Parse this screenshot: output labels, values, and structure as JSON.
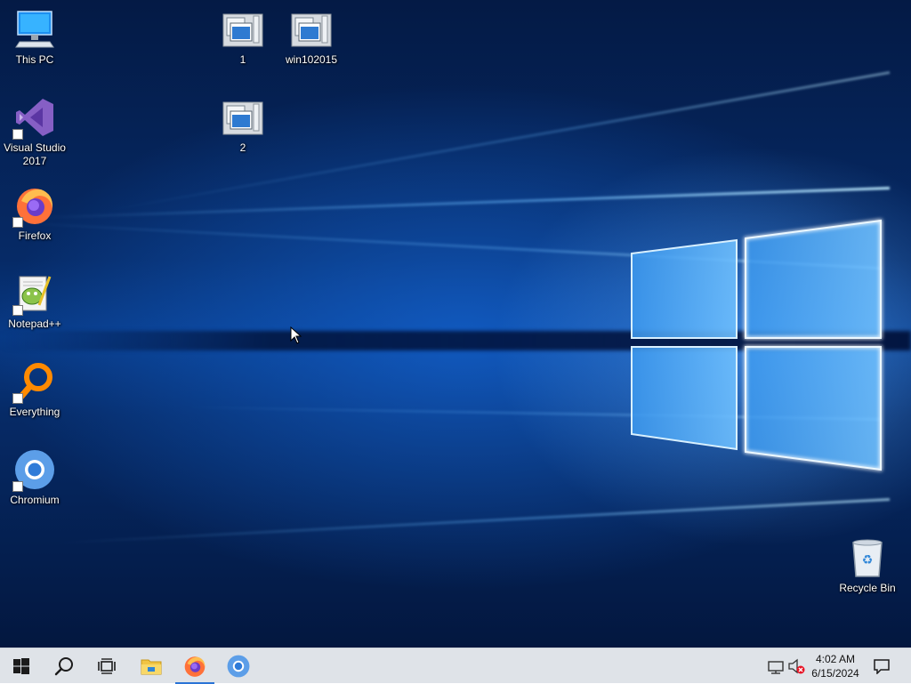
{
  "desktop_icons": {
    "this_pc": "This PC",
    "visual_studio": "Visual Studio 2017",
    "firefox": "Firefox",
    "notepadpp": "Notepad++",
    "everything": "Everything",
    "chromium": "Chromium",
    "file_1": "1",
    "file_win102015": "win102015",
    "file_2": "2",
    "recycle_bin": "Recycle Bin"
  },
  "taskbar": {
    "icons": [
      "windows-start-icon",
      "search-icon",
      "task-view-icon",
      "file-explorer-icon",
      "firefox-icon",
      "chromium-icon"
    ],
    "active_app": "firefox",
    "clock_time": "4:02 AM",
    "clock_date": "6/15/2024"
  },
  "colors": {
    "taskbar_bg": "#dfe3e8",
    "accent": "#2b74d6"
  }
}
